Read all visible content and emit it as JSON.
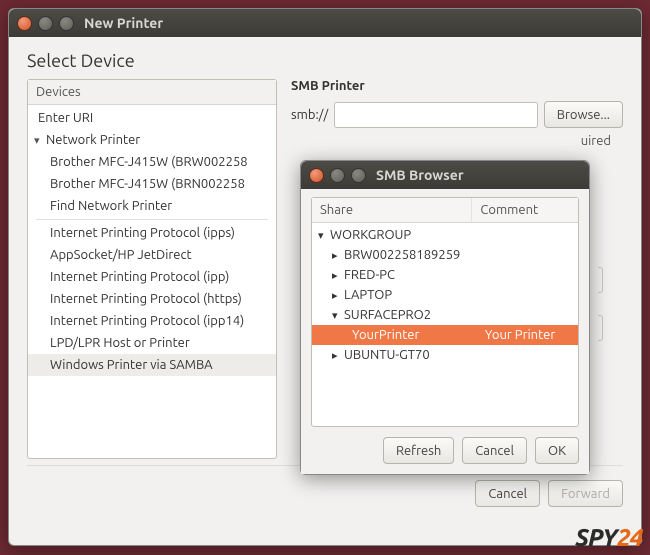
{
  "main_window": {
    "title": "New Printer",
    "heading": "Select Device",
    "devices_header": "Devices",
    "tree": {
      "enter_uri": "Enter URI",
      "network_printer": "Network Printer",
      "children": [
        "Brother MFC-J415W (BRW002258",
        "Brother MFC-J415W (BRN002258",
        "Find Network Printer"
      ],
      "group2": [
        "Internet Printing Protocol (ipps)",
        "AppSocket/HP JetDirect",
        "Internet Printing Protocol (ipp)",
        "Internet Printing Protocol (https)",
        "Internet Printing Protocol (ipp14)",
        "LPD/LPR Host or Printer",
        "Windows Printer via SAMBA"
      ]
    },
    "smb_title": "SMB Printer",
    "smb_prefix": "smb://",
    "browse_btn": "Browse...",
    "required_text": "uired",
    "cancel": "Cancel",
    "forward": "Forward"
  },
  "dialog": {
    "title": "SMB Browser",
    "col_share": "Share",
    "col_comment": "Comment",
    "rows": {
      "workgroup": "WORKGROUP",
      "r1": "BRW002258189259",
      "r2": "FRED-PC",
      "r3": "LAPTOP",
      "r4": "SURFACEPRO2",
      "r4_child_share": "YourPrinter",
      "r4_child_comment": "Your Printer",
      "r5": "UBUNTU-GT70"
    },
    "refresh": "Refresh",
    "cancel": "Cancel",
    "ok": "OK"
  },
  "watermark": {
    "a": "SPY",
    "b": "24"
  }
}
